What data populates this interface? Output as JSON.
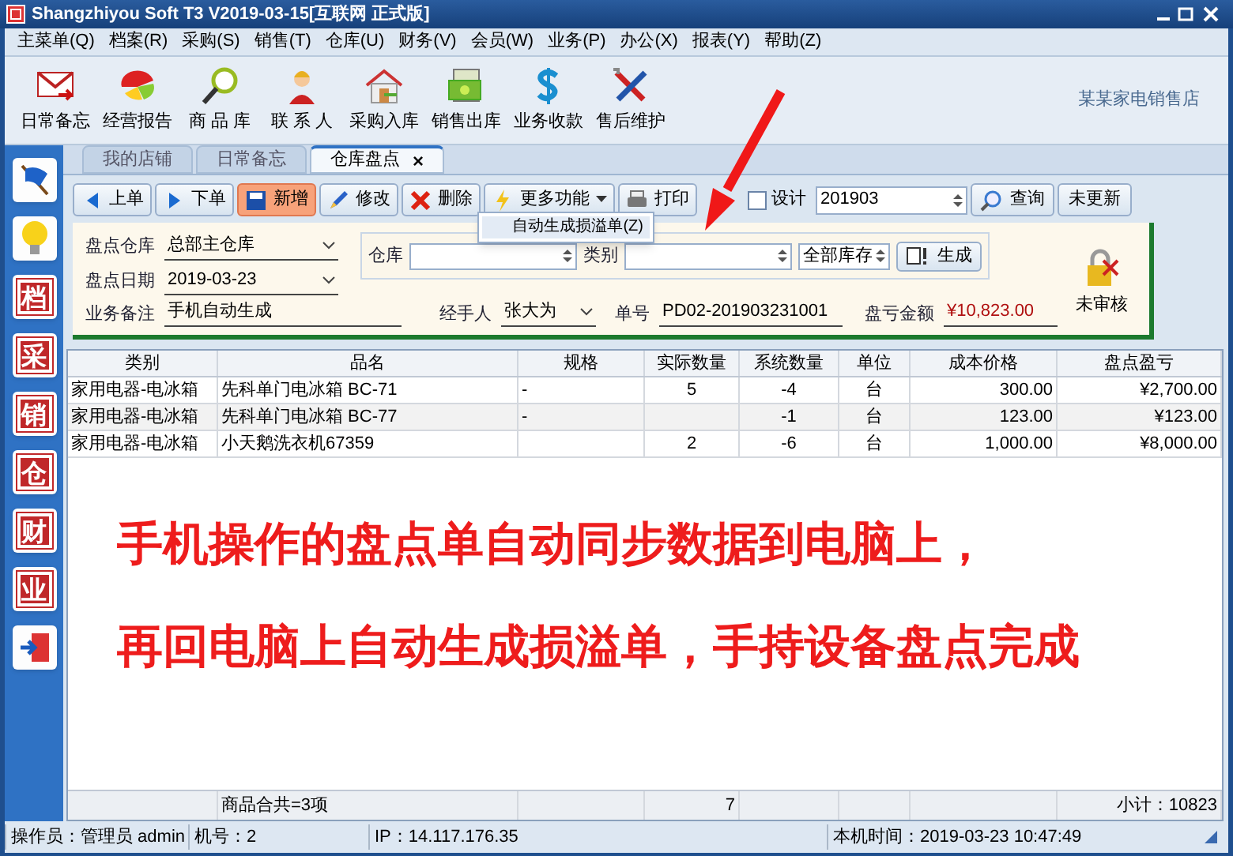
{
  "window": {
    "title": "Shangzhiyou Soft T3 V2019-03-15[互联网 正式版]"
  },
  "menu": [
    "主菜单(Q)",
    "档案(R)",
    "采购(S)",
    "销售(T)",
    "仓库(U)",
    "财务(V)",
    "会员(W)",
    "业务(P)",
    "办公(X)",
    "报表(Y)",
    "帮助(Z)"
  ],
  "toolbar": [
    {
      "label": "日常备忘",
      "kind": "mail"
    },
    {
      "label": "经营报告",
      "kind": "pie"
    },
    {
      "label": "商 品 库",
      "kind": "magnifier"
    },
    {
      "label": "联 系 人",
      "kind": "person"
    },
    {
      "label": "采购入库",
      "kind": "house"
    },
    {
      "label": "销售出库",
      "kind": "money"
    },
    {
      "label": "业务收款",
      "kind": "dollar"
    },
    {
      "label": "售后维护",
      "kind": "tools"
    }
  ],
  "store_name": "某某家电销售店",
  "sidebar": [
    {
      "kind": "flag"
    },
    {
      "kind": "bulb"
    },
    {
      "kind": "glyph",
      "label": "档"
    },
    {
      "kind": "glyph",
      "label": "采"
    },
    {
      "kind": "glyph",
      "label": "销"
    },
    {
      "kind": "glyph",
      "label": "仓"
    },
    {
      "kind": "glyph",
      "label": "财"
    },
    {
      "kind": "glyph",
      "label": "业"
    },
    {
      "kind": "exit"
    }
  ],
  "tabs": [
    {
      "label": "我的店铺",
      "selected": false
    },
    {
      "label": "日常备忘",
      "selected": false
    },
    {
      "label": "仓库盘点",
      "selected": true,
      "close": "×"
    }
  ],
  "actions": [
    {
      "label": "上单",
      "kind": "prev",
      "highlighted": false
    },
    {
      "label": "下单",
      "kind": "next",
      "highlighted": false
    },
    {
      "label": "新增",
      "kind": "save",
      "highlighted": true
    },
    {
      "label": "修改",
      "kind": "edit",
      "highlighted": false
    },
    {
      "label": "删除",
      "kind": "delete",
      "highlighted": false
    },
    {
      "label": "更多功能",
      "kind": "more",
      "highlighted": false
    },
    {
      "label": "打印",
      "kind": "print",
      "highlighted": false
    }
  ],
  "dropdown": {
    "items": [
      "自动生成损溢单(Z)"
    ]
  },
  "design_checkbox": {
    "label": "设计",
    "checked": false
  },
  "period_field": {
    "value": "201903"
  },
  "query_button": "查询",
  "refresh_button": "未更新",
  "form": {
    "warehouse": {
      "label": "盘点仓库",
      "value": "总部主仓库"
    },
    "date": {
      "label": "盘点日期",
      "value": "2019-03-23"
    },
    "note": {
      "label": "业务备注",
      "value": "手机自动生成"
    },
    "handler": {
      "label": "经手人",
      "value": "张大为"
    },
    "number": {
      "label": "单号",
      "value": "PD02-201903231001"
    },
    "loss": {
      "label": "盘亏金额",
      "value": "¥10,823.00"
    },
    "filter": {
      "warehouse_label": "仓库",
      "category_label": "类别",
      "stock": "全部库存",
      "generate": "生成"
    },
    "status": "未审核"
  },
  "table": {
    "columns": [
      "类别",
      "品名",
      "规格",
      "实际数量",
      "系统数量",
      "单位",
      "成本价格",
      "盘点盈亏"
    ],
    "rows": [
      [
        "家用电器-电冰箱",
        "先科单门电冰箱 BC-71",
        "-",
        "5",
        "-4",
        "台",
        "300.00",
        "¥2,700.00"
      ],
      [
        "家用电器-电冰箱",
        "先科单门电冰箱 BC-77",
        "-",
        "",
        "-1",
        "台",
        "123.00",
        "¥123.00"
      ],
      [
        "家用电器-电冰箱",
        "小天鹅洗衣机67359",
        "",
        "2",
        "-6",
        "台",
        "1,000.00",
        "¥8,000.00"
      ]
    ],
    "footer": {
      "count": "商品合共=3项",
      "quantity": "7",
      "subtotal": "小计：10823"
    }
  },
  "status_bar": [
    "操作员：管理员 admin",
    "机号：2",
    "IP：14.117.176.35",
    "本机时间：2019-03-23 10:47:49"
  ],
  "annotation": {
    "lines": [
      "手机操作的盘点单自动同步数据到电脑上，",
      "再回电脑上自动生成损溢单，手持设备盘点完成"
    ]
  }
}
